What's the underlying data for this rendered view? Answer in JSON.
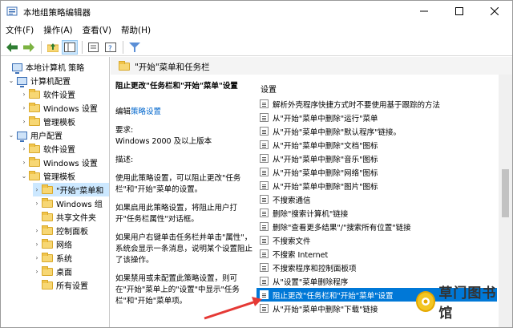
{
  "window": {
    "title": "本地组策略编辑器",
    "controls": {
      "minimize": "—",
      "maximize": "☐",
      "close": "✕"
    }
  },
  "menubar": {
    "items": [
      "文件(F)",
      "操作(A)",
      "查看(V)",
      "帮助(H)"
    ]
  },
  "toolbar": {
    "icons": [
      "back-arrow-icon",
      "forward-arrow-icon",
      "up-folder-icon",
      "show-hide-tree-icon",
      "export-list-icon",
      "help-icon",
      "properties-icon",
      "filter-icon"
    ]
  },
  "tree": {
    "items": [
      {
        "label": "本地计算机 策略",
        "icon": "computer-policy-icon"
      },
      {
        "label": "计算机配置",
        "icon": "computer-icon"
      },
      {
        "label": "软件设置",
        "icon": "folder-icon"
      },
      {
        "label": "Windows 设置",
        "icon": "folder-icon"
      },
      {
        "label": "管理模板",
        "icon": "folder-icon"
      },
      {
        "label": "用户配置",
        "icon": "user-icon"
      },
      {
        "label": "软件设置",
        "icon": "folder-icon"
      },
      {
        "label": "Windows 设置",
        "icon": "folder-icon"
      },
      {
        "label": "管理模板",
        "icon": "folder-icon"
      },
      {
        "label": "\"开始\"菜单和",
        "icon": "folder-icon"
      },
      {
        "label": "Windows 组",
        "icon": "folder-icon"
      },
      {
        "label": "共享文件夹",
        "icon": "folder-icon"
      },
      {
        "label": "控制面板",
        "icon": "folder-icon"
      },
      {
        "label": "网络",
        "icon": "folder-icon"
      },
      {
        "label": "系统",
        "icon": "folder-icon"
      },
      {
        "label": "桌面",
        "icon": "folder-icon"
      },
      {
        "label": "所有设置",
        "icon": "folder-icon"
      }
    ]
  },
  "main": {
    "header": "\"开始\"菜单和任务栏",
    "description": {
      "title": "阻止更改\"任务栏和\"开始\"菜单\"设置",
      "edit_prefix": "编辑",
      "edit_link": "策略设置",
      "req_label": "要求:",
      "req_value": "Windows 2000 及以上版本",
      "desc_label": "描述:",
      "p1": "使用此策略设置，可以阻止更改\"任务栏\"和\"开始\"菜单的设置。",
      "p2": "如果启用此策略设置，将阻止用户打开\"任务栏属性\"对话框。",
      "p3": "如果用户右键单击任务栏并单击\"属性\"，系统会显示一条消息，说明某个设置阻止了该操作。",
      "p4": "如果禁用或未配置此策略设置，则可在\"开始\"菜单上的\"设置\"中显示\"任务栏\"和\"开始\"菜单项。"
    },
    "list": {
      "header": "设置",
      "items": [
        "解析外壳程序快捷方式时不要使用基于跟踪的方法",
        "从\"开始\"菜单中删除\"运行\"菜单",
        "从\"开始\"菜单中删除\"默认程序\"链接。",
        "从\"开始\"菜单中删除\"文档\"图标",
        "从\"开始\"菜单中删除\"音乐\"图标",
        "从\"开始\"菜单中删除\"网络\"图标",
        "从\"开始\"菜单中删除\"图片\"图标",
        "不搜索通信",
        "删除\"搜索计算机\"链接",
        "删除\"查看更多结果\"/\"搜索所有位置\"链接",
        "不搜索文件",
        "不搜索 Internet",
        "不搜索程序和控制面板项",
        "从\"设置\"菜单删除程序",
        "阻止更改\"任务栏和\"开始\"菜单\"设置",
        "从\"开始\"菜单中删除\"下载\"链接"
      ],
      "selected_index": 14
    }
  },
  "watermark": {
    "text": "草门图书馆"
  },
  "colors": {
    "selection": "#0078d7",
    "tree_selection": "#cce8ff",
    "annotation_arrow": "#e53935",
    "link": "#0066cc"
  }
}
